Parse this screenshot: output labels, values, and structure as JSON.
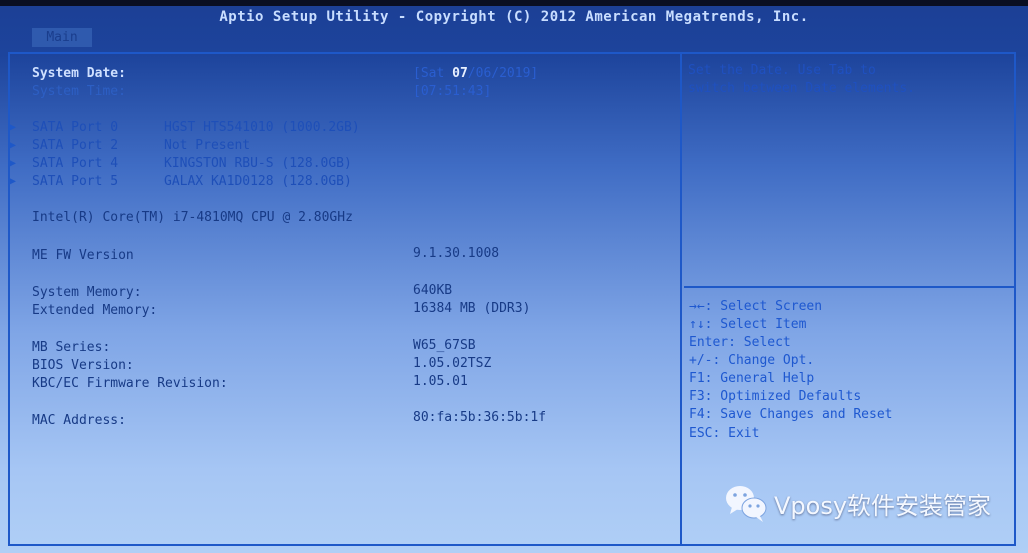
{
  "header": {
    "title": "Aptio Setup Utility - Copyright (C) 2012 American Megatrends, Inc.",
    "tabs": [
      {
        "label": "Main",
        "active": true
      }
    ]
  },
  "main": {
    "system_date": {
      "label": "System Date:",
      "prefix": "[Sat ",
      "highlight": "07",
      "suffix": "/06/2019]"
    },
    "system_time": {
      "label": "System Time:",
      "value": "[07:51:43]"
    },
    "sata_ports": [
      {
        "port": "SATA Port 0",
        "device": "HGST HTS541010 (1000.2GB)"
      },
      {
        "port": "SATA Port 2",
        "device": "Not Present"
      },
      {
        "port": "SATA Port 4",
        "device": "KINGSTON RBU-S (128.0GB)"
      },
      {
        "port": "SATA Port 5",
        "device": "GALAX KA1D0128 (128.0GB)"
      }
    ],
    "cpu": "Intel(R) Core(TM) i7-4810MQ CPU @ 2.80GHz",
    "info": [
      {
        "label": "ME FW Version",
        "value": "9.1.30.1008"
      },
      {
        "label": "System Memory:",
        "value": "640KB"
      },
      {
        "label": "Extended Memory:",
        "value": "16384 MB (DDR3)"
      },
      {
        "label": "MB Series:",
        "value": "W65_67SB"
      },
      {
        "label": "BIOS Version:",
        "value": "1.05.02TSZ"
      },
      {
        "label": "KBC/EC Firmware Revision:",
        "value": "1.05.01"
      },
      {
        "label": "MAC Address:",
        "value": "80:fa:5b:36:5b:1f"
      }
    ]
  },
  "help": {
    "lines": [
      "Set the Date. Use Tab to",
      "switch between Date elements."
    ]
  },
  "keys": [
    "→←: Select Screen",
    "↑↓: Select Item",
    "Enter: Select",
    "+/-: Change Opt.",
    "F1: General Help",
    "F3: Optimized Defaults",
    "F4: Save Changes and Reset",
    "ESC: Exit"
  ],
  "watermark": {
    "text": "Vposy软件安装管家",
    "icon": "wechat-icon"
  },
  "colors": {
    "frame": "#1e58c8",
    "title_bg": "#1c3f95",
    "text": "#173a86"
  }
}
